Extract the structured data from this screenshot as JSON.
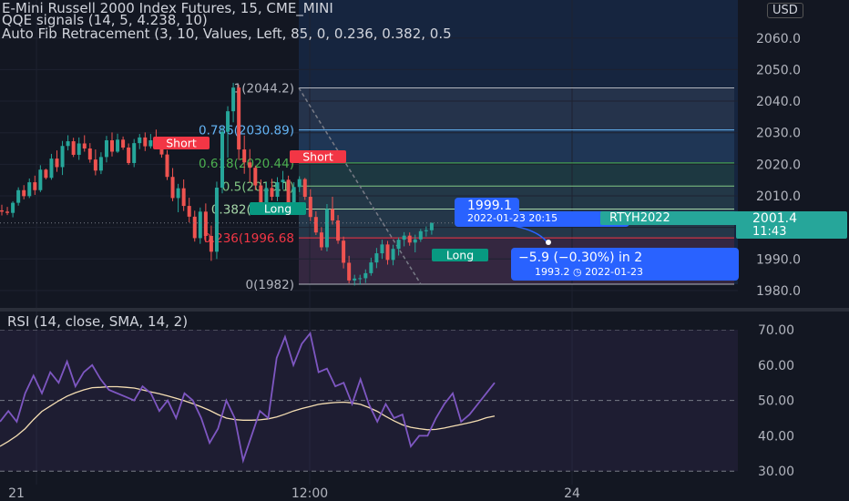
{
  "header": {
    "title": "E-Mini Russell 2000 Index Futures, 15, CME_MINI",
    "indicator_1": "QQE signals (14, 5, 4.238, 10)",
    "indicator_2": "Auto Fib Retracement (3, 10, Values, Left, 85, 0, 0.236, 0.382, 0.5"
  },
  "currency": "USD",
  "price_axis": {
    "ticks": [
      "2060.0",
      "2050.0",
      "2040.0",
      "2030.0",
      "2020.0",
      "2010.0",
      "2000.0",
      "1990.0",
      "1980.0"
    ]
  },
  "time_axis": {
    "ticks": [
      "21",
      "12:00",
      "24"
    ]
  },
  "fib_levels": [
    {
      "ratio": "1",
      "price": 2044.2,
      "label": "1(2044.2)",
      "color": "#b2b5be"
    },
    {
      "ratio": "0.786",
      "price": 2030.89,
      "label": "0.786(2030.89)",
      "color": "#64b5f6"
    },
    {
      "ratio": "0.618",
      "price": 2020.44,
      "label": "0.618(2020.44)",
      "color": "#4caf50"
    },
    {
      "ratio": "0.5",
      "price": 2013.1,
      "label": "0.5(2013.1)",
      "color": "#81c784"
    },
    {
      "ratio": "0.382",
      "price": 2005.8,
      "label": "0.382(2005.8",
      "color": "#a5d6a7"
    },
    {
      "ratio": "0.236",
      "price": 1996.68,
      "label": "0.236(1996.68",
      "color": "#f23645"
    },
    {
      "ratio": "0",
      "price": 1982,
      "label": "0(1982)",
      "color": "#b2b5be"
    }
  ],
  "signals": [
    {
      "text": "Short",
      "kind": "short"
    },
    {
      "text": "Short",
      "kind": "short"
    },
    {
      "text": "Long",
      "kind": "long"
    },
    {
      "text": "Long",
      "kind": "long"
    }
  ],
  "projection": {
    "price_label": "1999.1",
    "time_label": "2022-01-23 20:15",
    "change_label": "−5.9 (−0.30%) in 2",
    "target_label": "1993.2",
    "target_time": "2022-01-23"
  },
  "symbol_tag": "RTYH2022",
  "last_price": {
    "price": "2001.4",
    "countdown": "11:43"
  },
  "rsi": {
    "title": "RSI (14, close, SMA, 14, 2)",
    "ticks": [
      "70.00",
      "60.00",
      "50.00",
      "40.00",
      "30.00"
    ]
  },
  "chart_data": {
    "type": "candlestick",
    "title": "E-Mini Russell 2000 Index Futures, 15, CME_MINI",
    "ylim": [
      1976,
      2064
    ],
    "candles": [
      [
        2005.4,
        2007.2,
        2003.8,
        2005.0
      ],
      [
        2005.0,
        2006.5,
        2003.9,
        2004.6
      ],
      [
        2004.6,
        2008.3,
        2003.2,
        2007.8
      ],
      [
        2007.8,
        2012.7,
        2006.9,
        2011.8
      ],
      [
        2011.8,
        2013.4,
        2008.9,
        2009.9
      ],
      [
        2009.9,
        2015.5,
        2009.3,
        2014.3
      ],
      [
        2014.3,
        2016.4,
        2010.3,
        2011.8
      ],
      [
        2011.8,
        2019.7,
        2011.2,
        2018.3
      ],
      [
        2018.3,
        2018.6,
        2015.2,
        2015.7
      ],
      [
        2015.7,
        2023.3,
        2015.1,
        2021.8
      ],
      [
        2021.8,
        2024.4,
        2017.6,
        2019.1
      ],
      [
        2019.1,
        2027.4,
        2016.6,
        2025.8
      ],
      [
        2025.8,
        2029.2,
        2024.4,
        2027.3
      ],
      [
        2027.3,
        2028.4,
        2022.3,
        2023.0
      ],
      [
        2023.0,
        2028.5,
        2021.4,
        2026.6
      ],
      [
        2026.6,
        2029.2,
        2024.0,
        2025.0
      ],
      [
        2025.0,
        2026.7,
        2020.5,
        2021.5
      ],
      [
        2021.5,
        2024.7,
        2016.5,
        2018.0
      ],
      [
        2018.0,
        2023.8,
        2016.9,
        2022.3
      ],
      [
        2022.3,
        2029.0,
        2020.6,
        2027.6
      ],
      [
        2027.6,
        2030.1,
        2022.5,
        2024.0
      ],
      [
        2024.0,
        2029.7,
        2023.6,
        2027.8
      ],
      [
        2027.8,
        2028.8,
        2024.6,
        2025.3
      ],
      [
        2025.3,
        2026.6,
        2019.8,
        2020.4
      ],
      [
        2020.4,
        2028.0,
        2019.1,
        2026.7
      ],
      [
        2026.7,
        2029.6,
        2024.8,
        2028.5
      ],
      [
        2028.5,
        2030.1,
        2024.2,
        2025.7
      ],
      [
        2025.7,
        2029.6,
        2025.0,
        2027.6
      ],
      [
        2027.6,
        2031.0,
        2025.4,
        2026.2
      ],
      [
        2026.2,
        2027.4,
        2022.1,
        2023.1
      ],
      [
        2023.1,
        2024.5,
        2015.0,
        2016.0
      ],
      [
        2016.0,
        2018.8,
        2008.3,
        2009.3
      ],
      [
        2009.3,
        2013.8,
        2004.8,
        2012.4
      ],
      [
        2012.4,
        2015.2,
        2005.2,
        2006.8
      ],
      [
        2006.8,
        2009.4,
        2001.6,
        2003.4
      ],
      [
        2003.4,
        2005.3,
        1995.5,
        1996.6
      ],
      [
        1996.6,
        2006.3,
        1994.8,
        2005.0
      ],
      [
        2005.0,
        2007.6,
        1995.3,
        1997.3
      ],
      [
        1997.3,
        2000.6,
        1989.4,
        1992.3
      ],
      [
        1992.3,
        2014.5,
        1990.0,
        2012.6
      ],
      [
        2012.6,
        2031.8,
        2010.8,
        2030.3
      ],
      [
        2030.3,
        2038.4,
        2022.1,
        2036.8
      ],
      [
        2036.8,
        2045.8,
        2033.3,
        2044.3
      ],
      [
        2044.3,
        2045.2,
        2021.4,
        2024.7
      ],
      [
        2024.7,
        2029.1,
        2017.0,
        2020.6
      ],
      [
        2020.6,
        2024.8,
        2014.2,
        2018.9
      ],
      [
        2018.9,
        2019.6,
        2011.8,
        2013.3
      ],
      [
        2013.3,
        2015.2,
        2005.7,
        2007.0
      ],
      [
        2007.0,
        2014.3,
        2006.4,
        2012.5
      ],
      [
        2012.5,
        2015.4,
        2008.5,
        2009.7
      ],
      [
        2009.7,
        2015.9,
        2008.3,
        2014.3
      ],
      [
        2014.3,
        2017.9,
        2012.1,
        2015.1
      ],
      [
        2015.1,
        2016.4,
        2006.3,
        2007.1
      ],
      [
        2007.1,
        2014.3,
        2005.9,
        2012.8
      ],
      [
        2012.8,
        2016.2,
        2011.2,
        2015.3
      ],
      [
        2015.3,
        2015.7,
        2008.7,
        2009.7
      ],
      [
        2009.7,
        2012.1,
        2002.0,
        2003.3
      ],
      [
        2003.3,
        2005.1,
        1997.6,
        1998.4
      ],
      [
        1998.4,
        2000.1,
        1992.7,
        1993.7
      ],
      [
        1993.7,
        2007.4,
        1992.4,
        2005.8
      ],
      [
        2005.8,
        2009.7,
        2000.9,
        2002.2
      ],
      [
        2002.2,
        2003.9,
        1994.8,
        1995.8
      ],
      [
        1995.8,
        1997.1,
        1987.0,
        1988.8
      ],
      [
        1988.8,
        1991.0,
        1982.3,
        1983.2
      ],
      [
        1983.2,
        1985.0,
        1981.6,
        1983.8
      ],
      [
        1983.8,
        1985.0,
        1981.8,
        1983.9
      ],
      [
        1983.9,
        1986.7,
        1982.4,
        1985.5
      ],
      [
        1985.5,
        1990.4,
        1984.7,
        1988.9
      ],
      [
        1988.9,
        1993.5,
        1987.1,
        1991.8
      ],
      [
        1991.8,
        1996.1,
        1990.0,
        1994.6
      ],
      [
        1994.6,
        1995.7,
        1988.2,
        1989.7
      ],
      [
        1989.7,
        1994.5,
        1988.0,
        1993.2
      ],
      [
        1993.2,
        1996.8,
        1991.1,
        1996.1
      ],
      [
        1996.1,
        1998.5,
        1994.0,
        1997.4
      ],
      [
        1997.4,
        1998.4,
        1994.2,
        1995.2
      ],
      [
        1995.2,
        1997.7,
        1992.1,
        1996.2
      ],
      [
        1996.2,
        1999.5,
        1995.4,
        1998.8
      ],
      [
        1998.8,
        2000.3,
        1997.1,
        1999.1
      ],
      [
        1999.1,
        2001.6,
        1997.7,
        2001.4
      ]
    ],
    "rsi": [
      44,
      47,
      44,
      52,
      57,
      52,
      58,
      55,
      61,
      54,
      58,
      60,
      56,
      53,
      52,
      51,
      50,
      54,
      52,
      47,
      50,
      45,
      52,
      50,
      45,
      38,
      42,
      50,
      45,
      33,
      40,
      47,
      45,
      62,
      68,
      60,
      66,
      69,
      58,
      59,
      54,
      55,
      49,
      56,
      49,
      44,
      49,
      45,
      46,
      37,
      40,
      40,
      45,
      49,
      52,
      44,
      46,
      49,
      52,
      55
    ],
    "rsi_sma": [
      37.0,
      38.4,
      40.0,
      42.0,
      44.6,
      46.9,
      48.4,
      49.9,
      51.2,
      52.2,
      53.0,
      53.6,
      53.7,
      53.9,
      53.9,
      53.7,
      53.5,
      53.0,
      52.4,
      51.9,
      51.3,
      50.6,
      49.9,
      49.1,
      48.2,
      47.2,
      46.0,
      45.0,
      44.6,
      44.4,
      44.4,
      44.5,
      44.8,
      45.3,
      46.1,
      47.0,
      47.7,
      48.3,
      48.9,
      49.2,
      49.4,
      49.5,
      49.3,
      48.9,
      48.0,
      46.9,
      45.5,
      44.2,
      43.1,
      42.4,
      42.0,
      41.7,
      41.8,
      42.2,
      42.7,
      43.2,
      43.7,
      44.3,
      45.1,
      45.6
    ],
    "rsi_ylim": [
      27,
      73
    ],
    "rsi_bands": [
      70,
      50,
      30
    ]
  }
}
